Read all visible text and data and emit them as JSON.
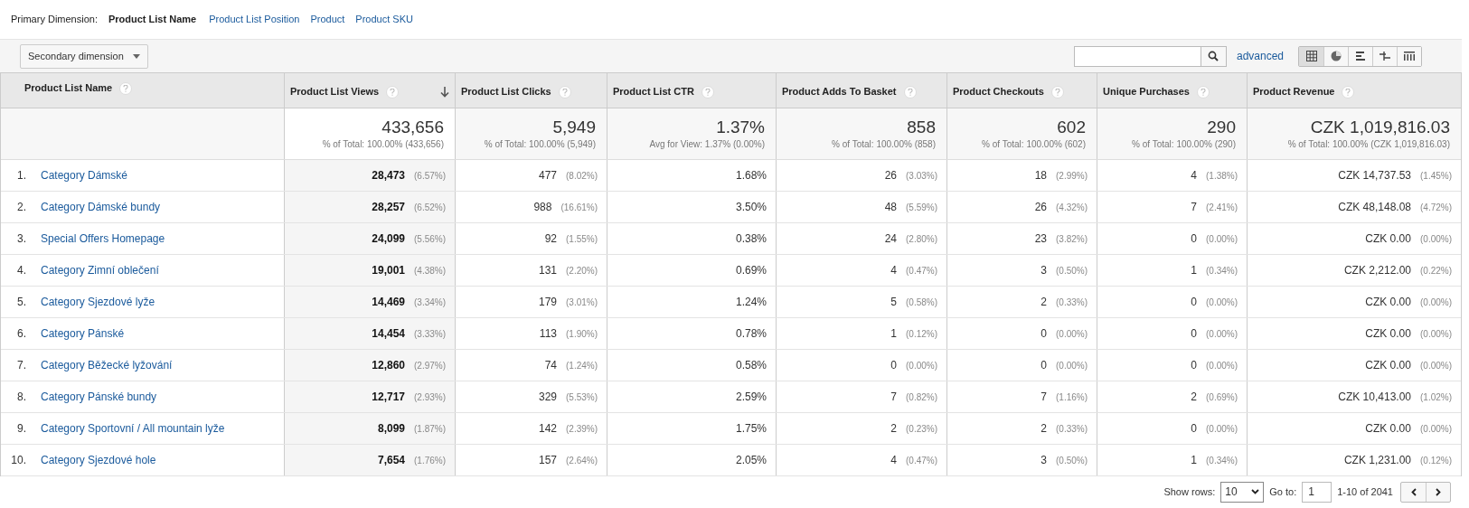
{
  "primary_dimension": {
    "label": "Primary Dimension:",
    "options": [
      {
        "label": "Product List Name",
        "selected": true
      },
      {
        "label": "Product List Position",
        "selected": false
      },
      {
        "label": "Product",
        "selected": false
      },
      {
        "label": "Product SKU",
        "selected": false
      }
    ]
  },
  "toolbar": {
    "secondary_dimension": "Secondary dimension",
    "advanced_link": "advanced",
    "views": [
      {
        "kind": "table",
        "selected": true
      },
      {
        "kind": "pie",
        "selected": false
      },
      {
        "kind": "bars",
        "selected": false
      },
      {
        "kind": "comparison",
        "selected": false
      },
      {
        "kind": "pivot",
        "selected": false
      }
    ]
  },
  "table": {
    "columns": [
      {
        "label": "Product List Name",
        "sorted": false
      },
      {
        "label": "Product List Views",
        "sorted": true
      },
      {
        "label": "Product List Clicks",
        "sorted": false
      },
      {
        "label": "Product List CTR",
        "sorted": false
      },
      {
        "label": "Product Adds To Basket",
        "sorted": false
      },
      {
        "label": "Product Checkouts",
        "sorted": false
      },
      {
        "label": "Unique Purchases",
        "sorted": false
      },
      {
        "label": "Product Revenue",
        "sorted": false
      }
    ],
    "totals": [
      {
        "value": "433,656",
        "note": "% of Total: 100.00% (433,656)"
      },
      {
        "value": "5,949",
        "note": "% of Total: 100.00% (5,949)"
      },
      {
        "value": "1.37%",
        "note": "Avg for View: 1.37% (0.00%)"
      },
      {
        "value": "858",
        "note": "% of Total: 100.00% (858)"
      },
      {
        "value": "602",
        "note": "% of Total: 100.00% (602)"
      },
      {
        "value": "290",
        "note": "% of Total: 100.00% (290)"
      },
      {
        "value": "CZK 1,019,816.03",
        "note": "% of Total: 100.00% (CZK 1,019,816.03)"
      }
    ],
    "rows": [
      {
        "index": "1.",
        "name": "Category Dámské",
        "cells": [
          {
            "value": "28,473",
            "share": "(6.57%)"
          },
          {
            "value": "477",
            "share": "(8.02%)"
          },
          {
            "value": "1.68%"
          },
          {
            "value": "26",
            "share": "(3.03%)"
          },
          {
            "value": "18",
            "share": "(2.99%)"
          },
          {
            "value": "4",
            "share": "(1.38%)"
          },
          {
            "value": "CZK 14,737.53",
            "share": "(1.45%)"
          }
        ]
      },
      {
        "index": "2.",
        "name": "Category Dámské bundy",
        "cells": [
          {
            "value": "28,257",
            "share": "(6.52%)"
          },
          {
            "value": "988",
            "share": "(16.61%)"
          },
          {
            "value": "3.50%"
          },
          {
            "value": "48",
            "share": "(5.59%)"
          },
          {
            "value": "26",
            "share": "(4.32%)"
          },
          {
            "value": "7",
            "share": "(2.41%)"
          },
          {
            "value": "CZK 48,148.08",
            "share": "(4.72%)"
          }
        ]
      },
      {
        "index": "3.",
        "name": "Special Offers Homepage",
        "cells": [
          {
            "value": "24,099",
            "share": "(5.56%)"
          },
          {
            "value": "92",
            "share": "(1.55%)"
          },
          {
            "value": "0.38%"
          },
          {
            "value": "24",
            "share": "(2.80%)"
          },
          {
            "value": "23",
            "share": "(3.82%)"
          },
          {
            "value": "0",
            "share": "(0.00%)"
          },
          {
            "value": "CZK 0.00",
            "share": "(0.00%)"
          }
        ]
      },
      {
        "index": "4.",
        "name": "Category Zimní oblečení",
        "cells": [
          {
            "value": "19,001",
            "share": "(4.38%)"
          },
          {
            "value": "131",
            "share": "(2.20%)"
          },
          {
            "value": "0.69%"
          },
          {
            "value": "4",
            "share": "(0.47%)"
          },
          {
            "value": "3",
            "share": "(0.50%)"
          },
          {
            "value": "1",
            "share": "(0.34%)"
          },
          {
            "value": "CZK 2,212.00",
            "share": "(0.22%)"
          }
        ]
      },
      {
        "index": "5.",
        "name": "Category Sjezdové lyže",
        "cells": [
          {
            "value": "14,469",
            "share": "(3.34%)"
          },
          {
            "value": "179",
            "share": "(3.01%)"
          },
          {
            "value": "1.24%"
          },
          {
            "value": "5",
            "share": "(0.58%)"
          },
          {
            "value": "2",
            "share": "(0.33%)"
          },
          {
            "value": "0",
            "share": "(0.00%)"
          },
          {
            "value": "CZK 0.00",
            "share": "(0.00%)"
          }
        ]
      },
      {
        "index": "6.",
        "name": "Category Pánské",
        "cells": [
          {
            "value": "14,454",
            "share": "(3.33%)"
          },
          {
            "value": "113",
            "share": "(1.90%)"
          },
          {
            "value": "0.78%"
          },
          {
            "value": "1",
            "share": "(0.12%)"
          },
          {
            "value": "0",
            "share": "(0.00%)"
          },
          {
            "value": "0",
            "share": "(0.00%)"
          },
          {
            "value": "CZK 0.00",
            "share": "(0.00%)"
          }
        ]
      },
      {
        "index": "7.",
        "name": "Category Běžecké lyžování",
        "cells": [
          {
            "value": "12,860",
            "share": "(2.97%)"
          },
          {
            "value": "74",
            "share": "(1.24%)"
          },
          {
            "value": "0.58%"
          },
          {
            "value": "0",
            "share": "(0.00%)"
          },
          {
            "value": "0",
            "share": "(0.00%)"
          },
          {
            "value": "0",
            "share": "(0.00%)"
          },
          {
            "value": "CZK 0.00",
            "share": "(0.00%)"
          }
        ]
      },
      {
        "index": "8.",
        "name": "Category Pánské bundy",
        "cells": [
          {
            "value": "12,717",
            "share": "(2.93%)"
          },
          {
            "value": "329",
            "share": "(5.53%)"
          },
          {
            "value": "2.59%"
          },
          {
            "value": "7",
            "share": "(0.82%)"
          },
          {
            "value": "7",
            "share": "(1.16%)"
          },
          {
            "value": "2",
            "share": "(0.69%)"
          },
          {
            "value": "CZK 10,413.00",
            "share": "(1.02%)"
          }
        ]
      },
      {
        "index": "9.",
        "name": "Category Sportovní / All mountain lyže",
        "cells": [
          {
            "value": "8,099",
            "share": "(1.87%)"
          },
          {
            "value": "142",
            "share": "(2.39%)"
          },
          {
            "value": "1.75%"
          },
          {
            "value": "2",
            "share": "(0.23%)"
          },
          {
            "value": "2",
            "share": "(0.33%)"
          },
          {
            "value": "0",
            "share": "(0.00%)"
          },
          {
            "value": "CZK 0.00",
            "share": "(0.00%)"
          }
        ]
      },
      {
        "index": "10.",
        "name": "Category Sjezdové hole",
        "cells": [
          {
            "value": "7,654",
            "share": "(1.76%)"
          },
          {
            "value": "157",
            "share": "(2.64%)"
          },
          {
            "value": "2.05%"
          },
          {
            "value": "4",
            "share": "(0.47%)"
          },
          {
            "value": "3",
            "share": "(0.50%)"
          },
          {
            "value": "1",
            "share": "(0.34%)"
          },
          {
            "value": "CZK 1,231.00",
            "share": "(0.12%)"
          }
        ]
      }
    ]
  },
  "pagination": {
    "show_rows_label": "Show rows:",
    "rows_value": "10",
    "goto_label": "Go to:",
    "goto_value": "1",
    "range": "1-10 of 2041"
  }
}
